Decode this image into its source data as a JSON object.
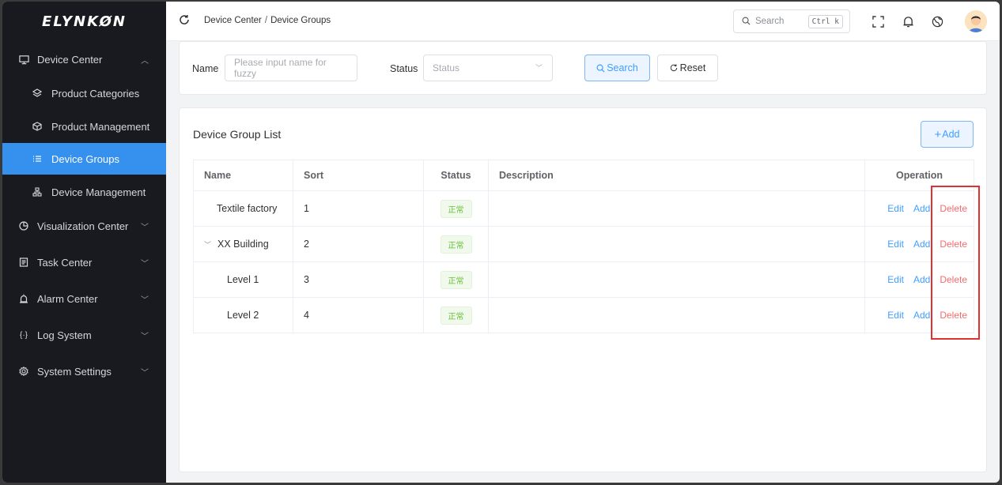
{
  "brand": {
    "logo": "ELYNKØN"
  },
  "sidebar": {
    "items": [
      {
        "label": "Device Center",
        "icon": "monitor-icon",
        "expanded": true
      },
      {
        "label": "Product Categories",
        "icon": "layers-icon"
      },
      {
        "label": "Product Management",
        "icon": "box-icon"
      },
      {
        "label": "Device Groups",
        "icon": "list-icon",
        "active": true
      },
      {
        "label": "Device Management",
        "icon": "tree-icon"
      },
      {
        "label": "Visualization Center",
        "icon": "pie-chart-icon"
      },
      {
        "label": "Task Center",
        "icon": "clipboard-icon"
      },
      {
        "label": "Alarm Center",
        "icon": "alarm-icon"
      },
      {
        "label": "Log System",
        "icon": "code-icon"
      },
      {
        "label": "System Settings",
        "icon": "gear-icon"
      }
    ]
  },
  "header": {
    "breadcrumb": [
      "Device Center",
      "Device Groups"
    ],
    "breadcrumb_sep": "/",
    "search": {
      "placeholder": "Search",
      "shortcut": "Ctrl k"
    }
  },
  "filter": {
    "name_label": "Name",
    "name_placeholder": "Please input name for fuzzy",
    "status_label": "Status",
    "status_placeholder": "Status",
    "search_label": "Search",
    "reset_label": "Reset"
  },
  "list": {
    "title": "Device Group List",
    "add_label": "Add",
    "columns": [
      "Name",
      "Sort",
      "Status",
      "Description",
      "Operation"
    ],
    "rows": [
      {
        "name": "Textile factory",
        "sort": "1",
        "status": "正常",
        "description": ""
      },
      {
        "name": "XX Building",
        "sort": "2",
        "status": "正常",
        "description": ""
      },
      {
        "name": "Level 1",
        "sort": "3",
        "status": "正常",
        "description": ""
      },
      {
        "name": "Level 2",
        "sort": "4",
        "status": "正常",
        "description": ""
      }
    ],
    "ops": {
      "edit": "Edit",
      "add": "Add",
      "delete": "Delete"
    }
  },
  "colors": {
    "sidebar_bg": "#181a1f",
    "active": "#3590ee",
    "primary": "#409eff",
    "danger": "#f56c6c",
    "success": "#67c23a",
    "highlight": "#e2302f"
  }
}
